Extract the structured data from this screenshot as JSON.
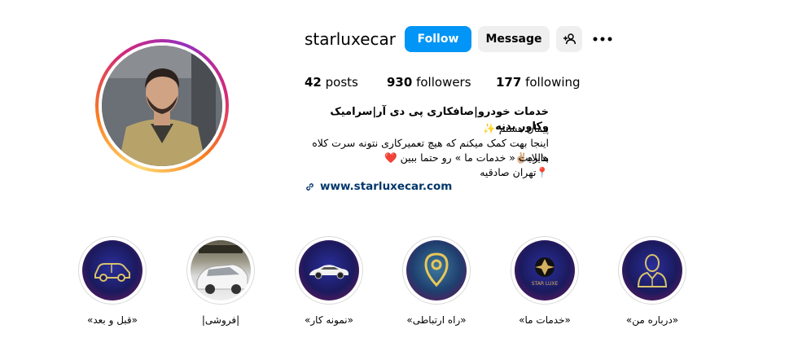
{
  "profile": {
    "username": "starluxecar",
    "follow_label": "Follow",
    "message_label": "Message"
  },
  "stats": {
    "posts": "42",
    "posts_label": "posts",
    "followers": "930",
    "followers_label": "followers",
    "following": "177",
    "following_label": "following"
  },
  "bio": {
    "title": "خدمات خودرو|صافکاری پی دی آر|سرامیک وکاور بدنه",
    "lines": [
      "پیمان هستم ✨",
      "اینجا بهت کمک میکنم که هیچ تعمیرکاری نتونه سرت کلاه بذاره✌🏼",
      "هایلایت « خدمات ما » رو حتما ببین ❤️",
      "📍تهران صادقیه"
    ],
    "link": "www.starluxecar.com"
  },
  "highlights": [
    {
      "label": "«قبل و بعد»",
      "icon": "car-outline-icon"
    },
    {
      "label": "|فروشی|",
      "icon": "white-car-photo"
    },
    {
      "label": "«نمونه کار»",
      "icon": "sports-car-icon"
    },
    {
      "label": "«راه ارتباطی»",
      "icon": "location-pin-icon"
    },
    {
      "label": "«خدمات ما»",
      "icon": "star-luxe-logo",
      "logo_text": "STAR LUXE"
    },
    {
      "label": "«درباره من»",
      "icon": "person-icon"
    }
  ],
  "colors": {
    "follow_button": "#0095f6",
    "secondary_button": "#efefef",
    "link": "#00376b"
  }
}
